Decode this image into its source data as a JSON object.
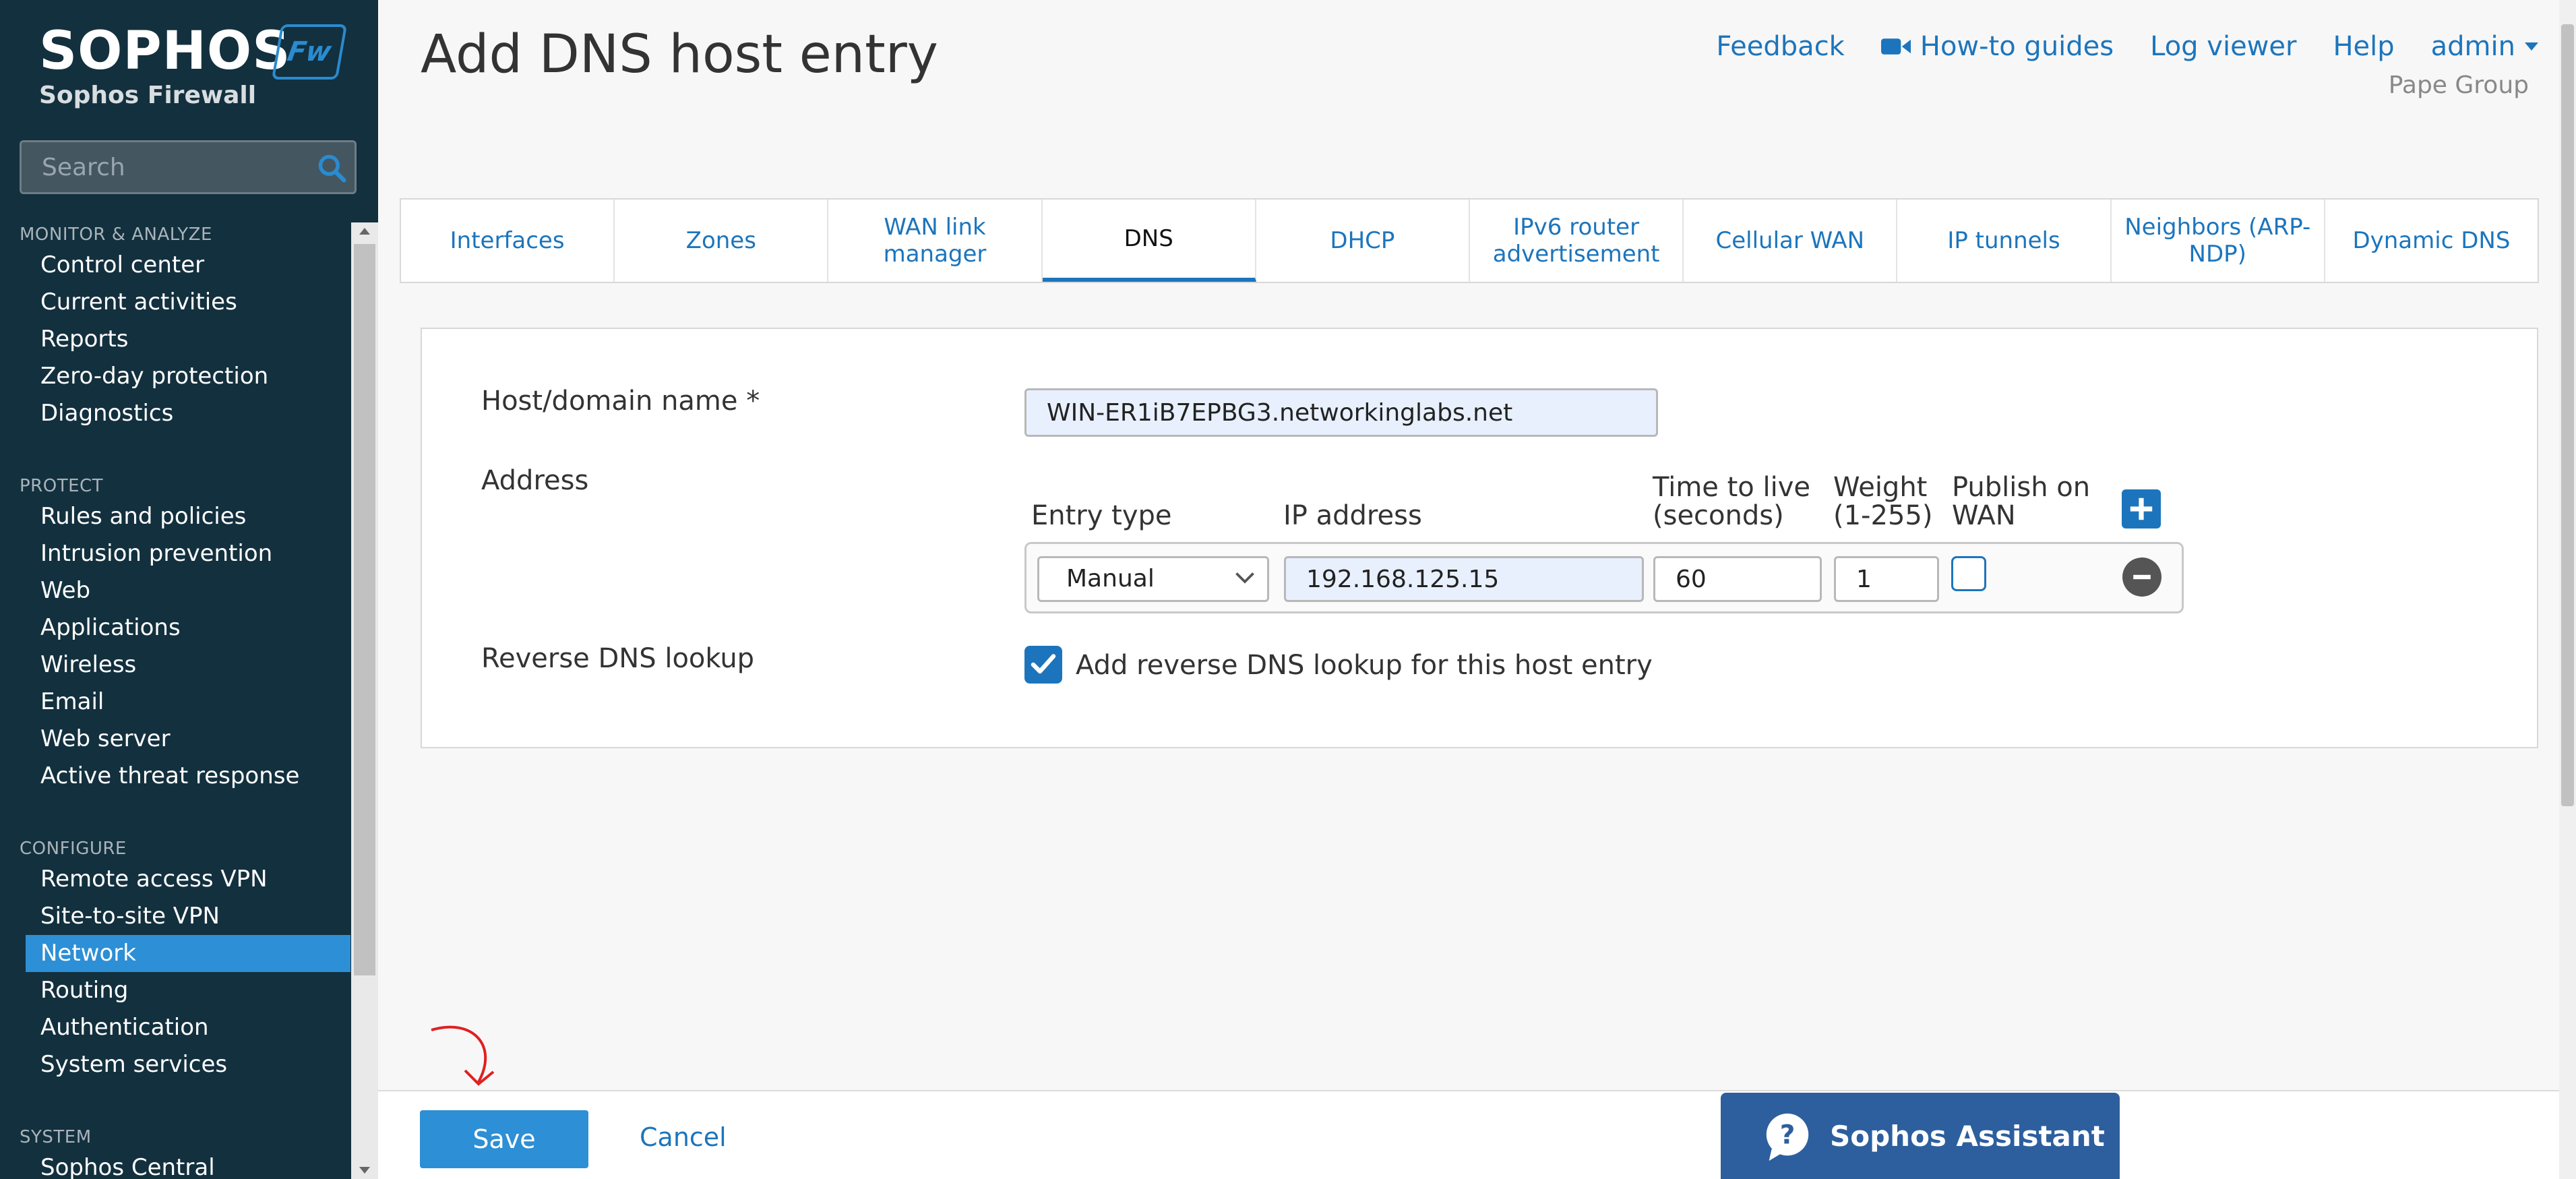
{
  "brand": {
    "logo": "SOPHOS",
    "product": "Sophos Firewall",
    "badge": "Fw"
  },
  "search": {
    "placeholder": "Search"
  },
  "sidebar": {
    "sections": [
      {
        "title": "MONITOR & ANALYZE",
        "items": [
          "Control center",
          "Current activities",
          "Reports",
          "Zero-day protection",
          "Diagnostics"
        ]
      },
      {
        "title": "PROTECT",
        "items": [
          "Rules and policies",
          "Intrusion prevention",
          "Web",
          "Applications",
          "Wireless",
          "Email",
          "Web server",
          "Active threat response"
        ]
      },
      {
        "title": "CONFIGURE",
        "items": [
          "Remote access VPN",
          "Site-to-site VPN",
          "Network",
          "Routing",
          "Authentication",
          "System services"
        ]
      },
      {
        "title": "SYSTEM",
        "items": [
          "Sophos Central"
        ]
      }
    ],
    "active_item": "Network"
  },
  "header": {
    "title": "Add DNS host entry",
    "links": {
      "feedback": "Feedback",
      "howto": "How-to guides",
      "logviewer": "Log viewer",
      "help": "Help",
      "admin": "admin"
    },
    "org": "Pape Group"
  },
  "tabs": [
    {
      "label": "Interfaces",
      "active": false
    },
    {
      "label": "Zones",
      "active": false
    },
    {
      "label": "WAN link manager",
      "active": false
    },
    {
      "label": "DNS",
      "active": true
    },
    {
      "label": "DHCP",
      "active": false
    },
    {
      "label": "IPv6 router advertisement",
      "active": false
    },
    {
      "label": "Cellular WAN",
      "active": false
    },
    {
      "label": "IP tunnels",
      "active": false
    },
    {
      "label": "Neighbors (ARP-NDP)",
      "active": false
    },
    {
      "label": "Dynamic DNS",
      "active": false
    }
  ],
  "form": {
    "host_label": "Host/domain name *",
    "host_value": "WIN-ER1iB7EPBG3.networkinglabs.net",
    "address_label": "Address",
    "columns": {
      "entry_type": "Entry type",
      "ip": "IP address",
      "ttl": "Time to live (seconds)",
      "weight": "Weight (1-255)",
      "publish": "Publish on WAN"
    },
    "row": {
      "entry_type": "Manual",
      "ip": "192.168.125.15",
      "ttl": "60",
      "weight": "1",
      "publish": false
    },
    "reverse_label": "Reverse DNS lookup",
    "reverse_text": "Add reverse DNS lookup for this host entry",
    "reverse_checked": true
  },
  "footer": {
    "save": "Save",
    "cancel": "Cancel"
  },
  "assistant": {
    "label": "Sophos Assistant"
  },
  "colors": {
    "sidebar_bg": "#13303e",
    "accent": "#2d8fd5",
    "link": "#1c75bc",
    "assistant_bg": "#2d5f9e",
    "annotation": "#e02020"
  }
}
